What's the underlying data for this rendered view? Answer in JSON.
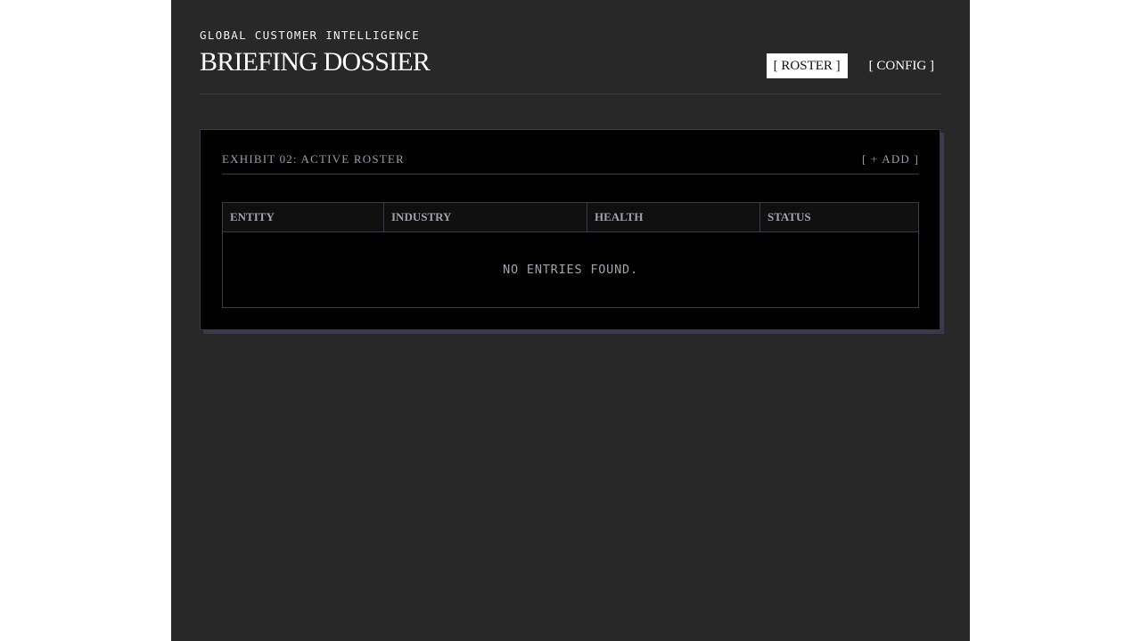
{
  "header": {
    "eyebrow": "GLOBAL CUSTOMER INTELLIGENCE",
    "title": "BRIEFING DOSSIER",
    "nav": [
      {
        "label": "[ ROSTER ]",
        "active": true
      },
      {
        "label": "[ CONFIG ]",
        "active": false
      }
    ]
  },
  "panel": {
    "title": "EXHIBIT 02: ACTIVE ROSTER",
    "add_label": "[ + ADD ]",
    "table": {
      "columns": [
        "ENTITY",
        "INDUSTRY",
        "HEALTH",
        "STATUS"
      ],
      "rows": [],
      "empty_message": "NO ENTRIES FOUND."
    }
  },
  "colors": {
    "page_background": "#282828",
    "panel_background": "#000000",
    "border": "#3a3a44",
    "muted_text": "#9c9ca8",
    "active_tab_background": "#ffffff"
  }
}
